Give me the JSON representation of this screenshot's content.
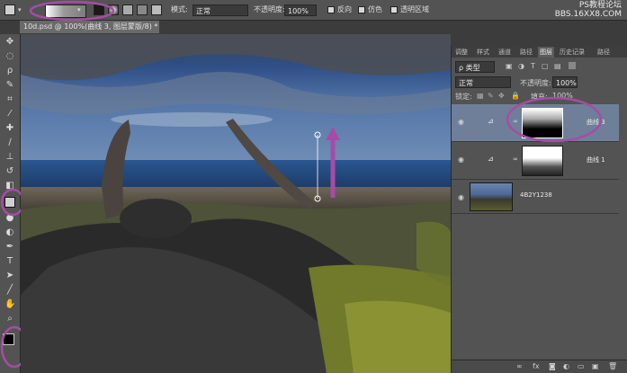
{
  "options": {
    "mode_label": "模式:",
    "mode_value": "正常",
    "opacity_label": "不透明度:",
    "opacity_value": "100%",
    "reverse_label": "反向",
    "dither_label": "仿色",
    "transparency_label": "透明区域"
  },
  "watermark": {
    "line1": "PS教程论坛",
    "line2": "BBS.16XX8.COM"
  },
  "document": {
    "tab_title": "10d.psd @ 100%(曲线 3, 图层蒙版/8) *"
  },
  "layers_panel": {
    "tabs": [
      "调整",
      "样式",
      "通道",
      "路径",
      "图层",
      "历史记录",
      "路径"
    ],
    "filter_label": "ρ 类型",
    "blend_mode": "正常",
    "opacity_label": "不透明度:",
    "opacity_value": "100%",
    "lock_label": "锁定:",
    "fill_label": "填充:",
    "fill_value": "100%",
    "layers": [
      {
        "name": "曲线 3",
        "selected": true
      },
      {
        "name": "曲线 1",
        "selected": false
      },
      {
        "name": "4B2Y1238",
        "selected": false
      }
    ]
  },
  "colors": {
    "annotation": "#a64ca6",
    "selected_layer": "#6f7f99"
  }
}
